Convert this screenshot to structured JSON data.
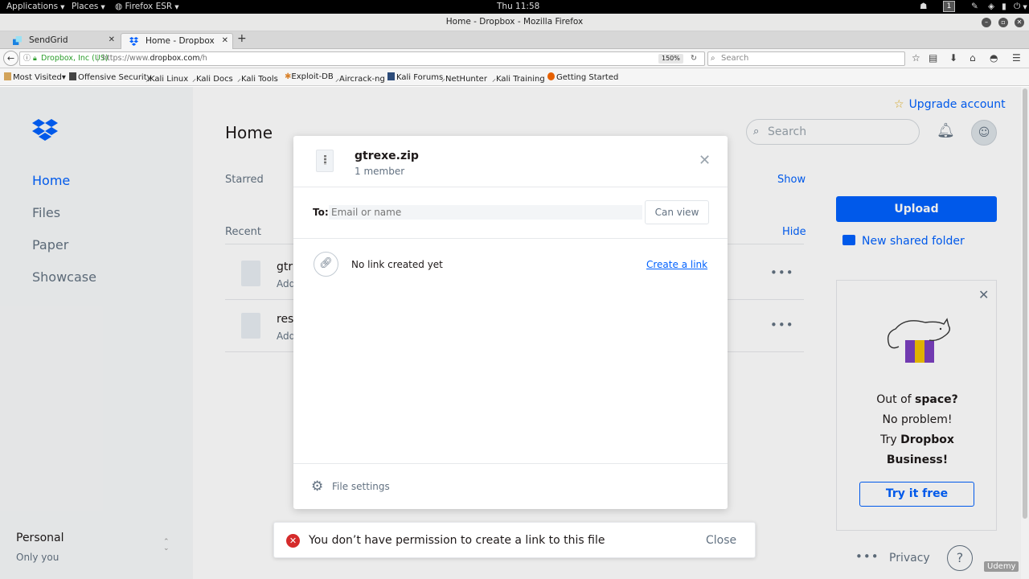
{
  "system_bar": {
    "applications": "Applications",
    "places": "Places",
    "firefox": "Firefox ESR",
    "clock": "Thu 11:58",
    "workspace": "1"
  },
  "window": {
    "title": "Home - Dropbox - Mozilla Firefox"
  },
  "tabs": [
    {
      "label": "SendGrid"
    },
    {
      "label": "Home - Dropbox"
    }
  ],
  "nav": {
    "site_identity": "Dropbox, Inc (US)",
    "url_prefix": "https://www.",
    "url_domain": "dropbox.com",
    "url_suffix": "/h",
    "zoom": "150%",
    "search_placeholder": "Search"
  },
  "bookmarks": [
    "Most Visited",
    "Offensive Security",
    "Kali Linux",
    "Kali Docs",
    "Kali Tools",
    "Exploit-DB",
    "Aircrack-ng",
    "Kali Forums",
    "NetHunter",
    "Kali Training",
    "Getting Started"
  ],
  "sidebar": {
    "items": [
      {
        "label": "Home"
      },
      {
        "label": "Files"
      },
      {
        "label": "Paper"
      },
      {
        "label": "Showcase"
      }
    ],
    "account_label": "Personal",
    "account_sub": "Only you"
  },
  "main": {
    "title": "Home",
    "starred": "Starred",
    "show": "Show",
    "recent": "Recent",
    "hide": "Hide",
    "rows": [
      {
        "name": "gtr",
        "sub": "Add"
      },
      {
        "name": "res",
        "sub": "Add"
      }
    ]
  },
  "right": {
    "upgrade": "Upgrade account",
    "search_placeholder": "Search",
    "upload": "Upload",
    "new_shared_folder": "New shared folder",
    "promo_line1a": "Out of ",
    "promo_line1b": "space?",
    "promo_line2": "No problem!",
    "promo_line3a": "Try ",
    "promo_line3b": "Dropbox",
    "promo_line4": "Business!",
    "try_free": "Try it free",
    "privacy": "Privacy",
    "help": "?"
  },
  "modal": {
    "file_name": "gtrexe.zip",
    "members": "1 member",
    "to_label": "To:",
    "to_placeholder": "Email or name",
    "permission": "Can view",
    "no_link": "No link created yet",
    "create_link": "Create a link",
    "file_settings": "File settings"
  },
  "toast": {
    "message": "You don’t have permission to create a link to this file",
    "close": "Close"
  },
  "watermark": "Udemy",
  "colors": {
    "dropbox_blue": "#0061fe",
    "error_red": "#d52b2b",
    "muted": "#637282"
  }
}
